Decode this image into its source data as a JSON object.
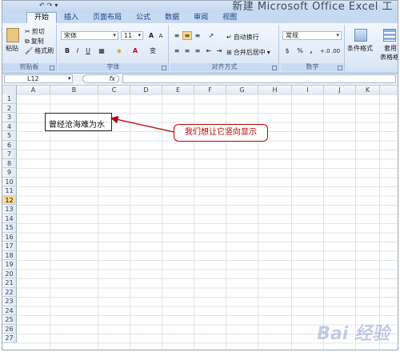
{
  "window": {
    "title": "新建 Microsoft Office Excel 工"
  },
  "tabs": [
    "开始",
    "插入",
    "页面布局",
    "公式",
    "数据",
    "审阅",
    "视图"
  ],
  "ribbon": {
    "clipboard": {
      "paste": "粘贴",
      "cut": "剪切",
      "copy": "复制",
      "format_painter": "格式刷",
      "label": "剪贴板"
    },
    "font": {
      "name": "宋体",
      "size": "11",
      "grow": "A",
      "shrink": "A",
      "bold": "B",
      "italic": "I",
      "underline": "U",
      "phonetic": "变",
      "label": "字体"
    },
    "alignment": {
      "wrap": "自动换行",
      "merge": "合并后居中",
      "label": "对齐方式"
    },
    "number": {
      "format": "常规",
      "label": "数字",
      "percent": "%",
      "comma": ","
    },
    "styles": {
      "conditional": "条件格式",
      "table": "套用",
      "table2": "表格格式"
    }
  },
  "formula_bar": {
    "cell_ref": "L12",
    "fx": "fx",
    "content": ""
  },
  "columns": [
    "A",
    "B",
    "C",
    "D",
    "E",
    "F",
    "G",
    "H",
    "I",
    "J",
    "K"
  ],
  "rows": [
    "1",
    "2",
    "3",
    "4",
    "5",
    "6",
    "7",
    "8",
    "9",
    "10",
    "11",
    "12",
    "13",
    "14",
    "15",
    "16",
    "17",
    "18",
    "19",
    "20",
    "21",
    "22",
    "23",
    "24",
    "25",
    "26",
    "27"
  ],
  "selected_row": "12",
  "cell_b3": "曾经沧海难为水",
  "callout": "我们想让它竖向显示",
  "watermark": "Bai 经验",
  "colors": {
    "accent": "#b00000",
    "selection": "#f9d99b",
    "ribbon": "#dde9f7"
  }
}
